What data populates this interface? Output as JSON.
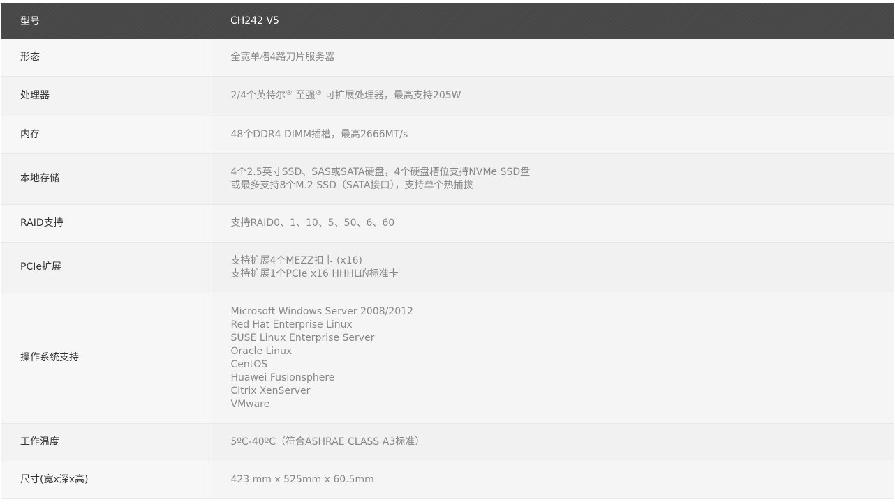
{
  "header": {
    "key": "型号",
    "value": "CH242 V5"
  },
  "rows": [
    {
      "key": "形态",
      "lines": [
        "全宽单槽4路刀片服务器"
      ]
    },
    {
      "key": "处理器",
      "lines": [
        "2/4个英特尔® 至强® 可扩展处理器，最高支持205W"
      ]
    },
    {
      "key": "内存",
      "lines": [
        "48个DDR4 DIMM插槽，最高2666MT/s"
      ]
    },
    {
      "key": "本地存储",
      "lines": [
        "4个2.5英寸SSD、SAS或SATA硬盘，4个硬盘槽位支持NVMe SSD盘",
        "或最多支持8个M.2 SSD（SATA接口），支持单个热插拔"
      ]
    },
    {
      "key": "RAID支持",
      "lines": [
        "支持RAID0、1、10、5、50、6、60"
      ]
    },
    {
      "key": "PCIe扩展",
      "lines": [
        "支持扩展4个MEZZ扣卡 (x16)",
        "支持扩展1个PCIe x16 HHHL的标准卡"
      ]
    },
    {
      "key": "操作系统支持",
      "lines": [
        "Microsoft Windows Server 2008/2012",
        "Red Hat Enterprise Linux",
        "SUSE Linux Enterprise Server",
        "Oracle Linux",
        "CentOS",
        "Huawei Fusionsphere",
        "Citrix XenServer",
        "VMware"
      ]
    },
    {
      "key": "工作温度",
      "lines": [
        "5ºC-40ºC（符合ASHRAE CLASS A3标准）"
      ]
    },
    {
      "key": "尺寸(宽x深x高)",
      "lines": [
        "423 mm x 525mm x 60.5mm"
      ]
    }
  ]
}
